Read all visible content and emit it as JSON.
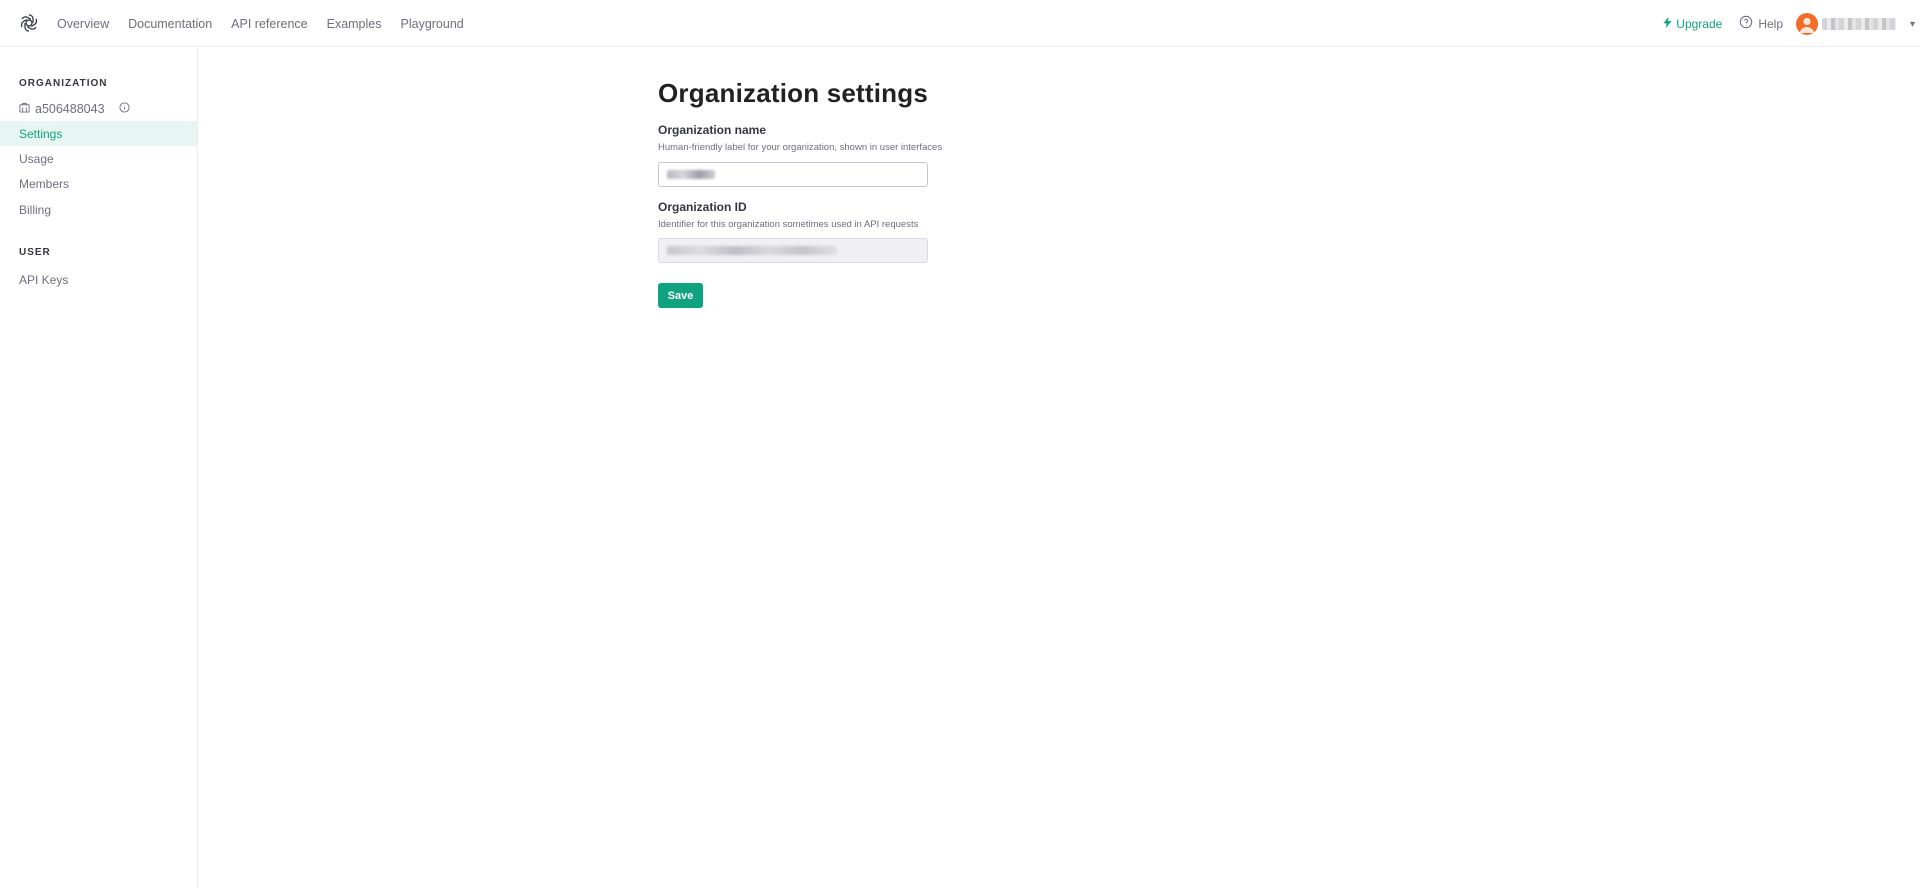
{
  "nav": {
    "items": [
      {
        "label": "Overview"
      },
      {
        "label": "Documentation"
      },
      {
        "label": "API reference"
      },
      {
        "label": "Examples"
      },
      {
        "label": "Playground"
      }
    ]
  },
  "header": {
    "upgrade_label": "Upgrade",
    "help_label": "Help",
    "user": {
      "name": ""
    }
  },
  "sidebar": {
    "org_heading": "ORGANIZATION",
    "org_id": "a506488043",
    "org_items": [
      {
        "label": "Settings",
        "active": true
      },
      {
        "label": "Usage"
      },
      {
        "label": "Members"
      },
      {
        "label": "Billing"
      }
    ],
    "user_heading": "USER",
    "user_items": [
      {
        "label": "API Keys"
      }
    ]
  },
  "main": {
    "title": "Organization settings",
    "org_name": {
      "label": "Organization name",
      "description": "Human-friendly label for your organization, shown in user interfaces",
      "value": ""
    },
    "org_id": {
      "label": "Organization ID",
      "description": "Identifier for this organization sometimes used in API requests",
      "value": ""
    },
    "save_label": "Save"
  },
  "colors": {
    "accent": "#10a37f",
    "active_bg": "#e7f6f2",
    "avatar": "#f26c2a",
    "text_primary": "#202123",
    "text_secondary": "#6e6e80",
    "border": "#ececf1"
  },
  "icons": {
    "logo": "openai-logo-icon",
    "upgrade": "lightning-icon",
    "help": "help-circle-icon",
    "org": "building-icon",
    "info": "info-circle-icon",
    "caret": "chevron-down-icon"
  }
}
